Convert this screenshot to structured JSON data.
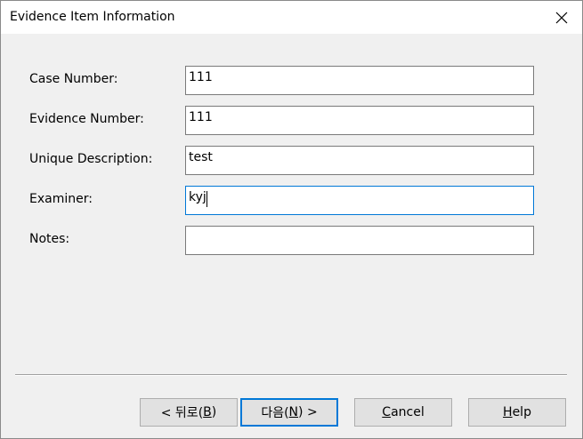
{
  "window": {
    "title": "Evidence Item Information"
  },
  "form": {
    "case_number": {
      "label": "Case Number:",
      "value": "111"
    },
    "evidence_number": {
      "label": "Evidence Number:",
      "value": "111"
    },
    "unique_description": {
      "label": "Unique Description:",
      "value": "test"
    },
    "examiner": {
      "label": "Examiner:",
      "value": "kyj"
    },
    "notes": {
      "label": "Notes:",
      "value": ""
    }
  },
  "buttons": {
    "back": {
      "prefix": "< 뒤로(",
      "mnemonic": "B",
      "suffix": ")"
    },
    "next": {
      "prefix": "다음(",
      "mnemonic": "N",
      "suffix": ") >"
    },
    "cancel": {
      "mnemonic": "C",
      "rest": "ancel"
    },
    "help": {
      "mnemonic": "H",
      "rest": "elp"
    }
  },
  "icons": {
    "close": "close-icon"
  }
}
